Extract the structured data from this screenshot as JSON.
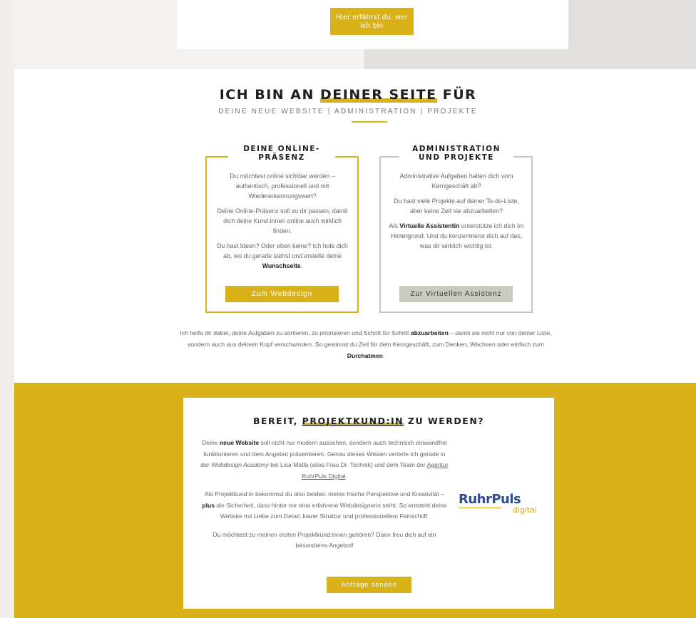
{
  "top": {
    "about_button": "Hier erfährst du, wer ich bin"
  },
  "hero": {
    "title_pre": "ICH BIN AN ",
    "title_highlight": "DEINER SEITE",
    "title_post": " FÜR",
    "subtitle": "DEINE NEUE WEBSITE | ADMINISTRATION | PROJEKTE"
  },
  "box_online": {
    "title": "DEINE ONLINE-PRÄSENZ",
    "p1": "Du möchtest online sichtbar werden – authentisch, professionell und mit Wiedererkennungswert?",
    "p2": "Deine Online-Präsenz soll zu dir passen, damit dich deine Kund:innen online auch wirklich finden.",
    "p3_pre": "Du hast Ideen? Oder eben keine? Ich hole dich ab, wo du gerade stehst und erstelle deine ",
    "p3_bold": "Wunschseite",
    "p3_post": ".",
    "button": "Zum Webdesign"
  },
  "box_admin": {
    "title": "ADMINISTRATION UND PROJEKTE",
    "p1": "Administrative Aufgaben halten dich vom Kerngeschäft ab?",
    "p2": "Du hast viele Projekte auf deiner To-do-Liste, aber keine Zeit sie abzuarbeiten?",
    "p3_pre": "Als ",
    "p3_bold": "Virtuelle Assistentin",
    "p3_post": " unterstütze ich dich im Hintergrund. Und du konzentrierst dich auf das, was dir wirklich wichtig ist.",
    "button": "Zur Virtuellen Assistenz"
  },
  "summary": {
    "pre": "Ich helfe dir dabei, deine Aufgaben zu sortieren, zu priorisieren und Schritt für Schritt ",
    "bold1": "abzuarbeiten",
    "mid": " – damit sie nicht nur von deiner Liste, sondern auch aus deinem Kopf verschwinden. So gewinnst du Zeit für dein Kerngeschäft, zum Denken, Wachsen oder einfach zum ",
    "bold2": "Durchatmen",
    "post": "."
  },
  "cta": {
    "title_pre": "BEREIT, ",
    "title_highlight": "PROJEKTKUND:IN",
    "title_post": " ZU WERDEN?",
    "p1_a": "Deine ",
    "p1_b": "neue Website",
    "p1_c": " soll nicht nur modern aussehen, sondern auch technisch einwandfrei funktionieren und dein Angebot präsentieren. Genau dieses Wissen vertiefe ich gerade in der ",
    "p1_d": "Webdesign Academy",
    "p1_e": " bei Lisa Matla (alias Frau Dr. Technik) und dem Team der ",
    "p1_link": "Agentur RuhrPuls Digital",
    "p1_f": ".",
    "p2_a": "Als Projektkund:in bekommst du also beides: meine frische Perspektive und Kreativität – ",
    "p2_b": "plus",
    "p2_c": " die Sicherheit, dass hinter mir eine erfahrene Webdesignerin steht. So entsteht deine Website mit Liebe zum Detail, klarer Struktur und professionellem Feinschliff.",
    "p3": "Du möchtest zu meinen ersten Projektkund:innen gehören? Dann freu dich auf ein besonderes Angebot!",
    "button": "Anfrage senden",
    "logo_top": "RuhrPuls",
    "logo_bottom": "digital"
  },
  "colors": {
    "accent": "#d9b118",
    "logo_blue": "#2e4c8f",
    "logo_orange": "#e2a41a",
    "gray_button": "#c9ccbe"
  }
}
